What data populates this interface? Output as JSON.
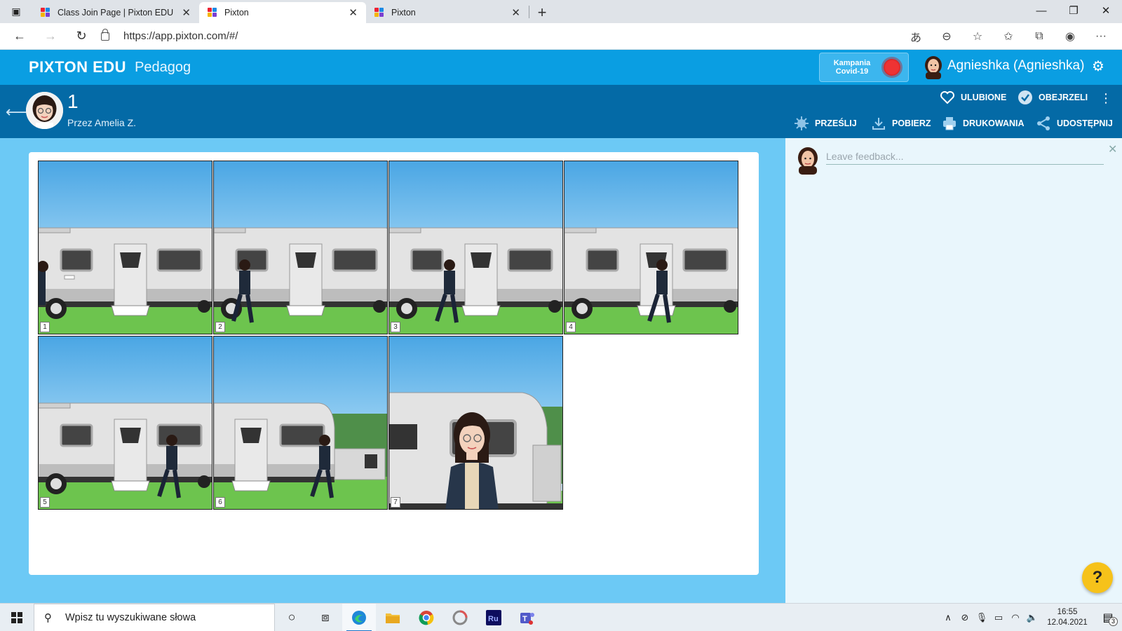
{
  "browser": {
    "tabs": [
      {
        "label": "Class Join Page | Pixton EDU",
        "active": false
      },
      {
        "label": "Pixton",
        "active": true
      },
      {
        "label": "Pixton",
        "active": false
      }
    ],
    "url": "https://app.pixton.com/#/"
  },
  "header": {
    "brand": "PIXTON EDU",
    "role": "Pedagog",
    "campaign_line1": "Kampania",
    "campaign_line2": "Covid-19",
    "username": "Agnieshka (Agnieshka)"
  },
  "comic": {
    "title": "1",
    "author": "Przez Amelia Z.",
    "actions": {
      "favorites": "ULUBIONE",
      "viewed": "OBEJRZELI",
      "submit": "PRZEŚLIJ",
      "download": "POBIERZ",
      "print": "DRUKOWANIA",
      "share": "UDOSTĘPNIJ"
    },
    "panels": [
      "1",
      "2",
      "3",
      "4",
      "5",
      "6",
      "7"
    ]
  },
  "feedback": {
    "placeholder": "Leave feedback..."
  },
  "help": {
    "label": "?"
  },
  "taskbar": {
    "search_placeholder": "Wpisz tu wyszukiwane słowa",
    "time": "16:55",
    "date": "12.04.2021",
    "notifications": "3"
  },
  "colors": {
    "header": "#0a9ee2",
    "infobar": "#046aa6",
    "main_bg": "#6cc9f5",
    "help_button": "#f6c21a"
  }
}
